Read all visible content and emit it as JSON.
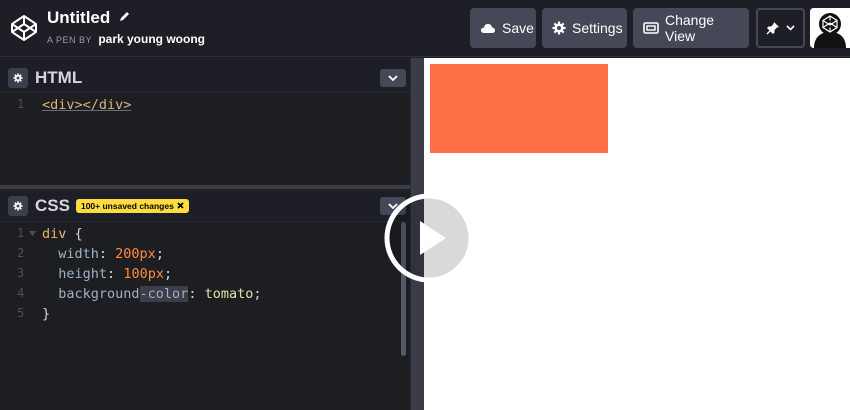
{
  "header": {
    "title": "Untitled",
    "byline_prefix": "A PEN BY",
    "author": "park young woong",
    "buttons": {
      "save": "Save",
      "settings": "Settings",
      "change_view": "Change View"
    }
  },
  "html_editor": {
    "title": "HTML",
    "lines": [
      {
        "num": "1",
        "code": "<div></div>"
      }
    ]
  },
  "css_editor": {
    "title": "CSS",
    "badge": "100+ unsaved changes",
    "lines": [
      {
        "num": "1"
      },
      {
        "num": "2"
      },
      {
        "num": "3"
      },
      {
        "num": "4"
      },
      {
        "num": "5"
      }
    ],
    "code": {
      "l1_selector": "div",
      "l1_brace": " {",
      "l2_prop": "width",
      "l2_value": "200px",
      "l3_prop": "height",
      "l3_value": "100px",
      "l4_prop_a": "background",
      "l4_prop_b": "-color",
      "l4_value": "tomato",
      "l5_brace": "}"
    }
  },
  "preview": {
    "box_color": "#ff7048"
  },
  "icons": {
    "logo": "codepen-logo-icon",
    "pencil": "pencil-icon",
    "save": "cloud-icon",
    "settings": "gear-icon",
    "change_view": "layout-icon",
    "pin": "pin-icon",
    "collapse": "chevron-down-icon",
    "play": "play-icon"
  }
}
